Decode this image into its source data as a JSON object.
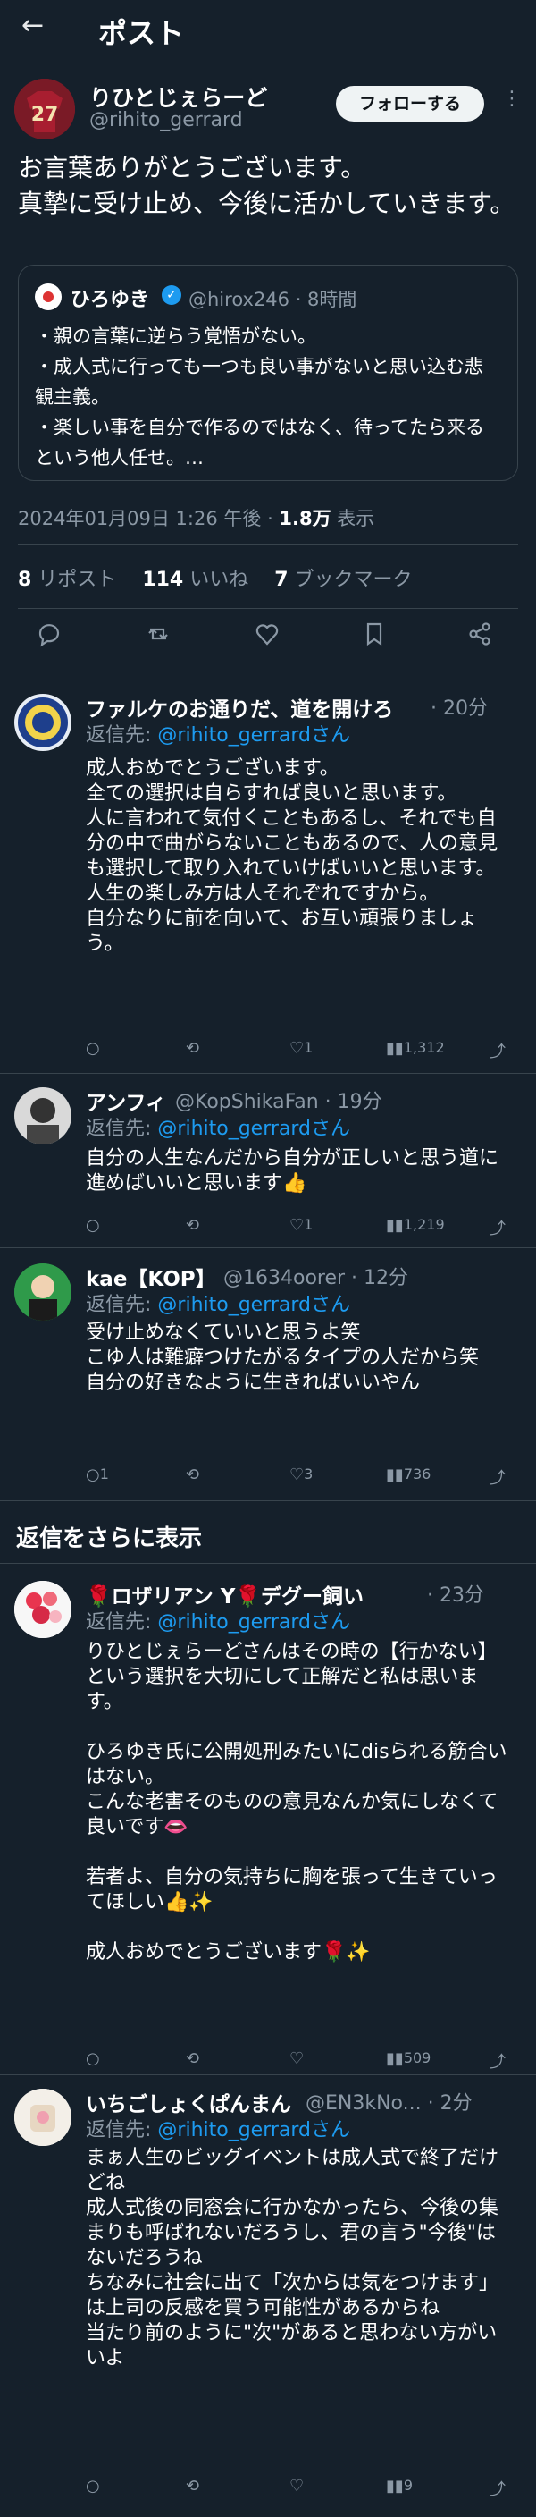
{
  "header": {
    "back_icon": "←",
    "title": "ポスト"
  },
  "main_post": {
    "author_name": "りひとじぇらーど",
    "author_handle": "@rihito_gerrard",
    "avatar_text": "27",
    "follow_label": "フォローする",
    "more_icon": "⋮",
    "text": "お言葉ありがとうございます。\n真摯に受け止め、今後に活かしていきます。",
    "quote": {
      "name": "ひろゆき",
      "handle": "@hirox246 · 8時間",
      "text": "・親の言葉に逆らう覚悟がない。\n・成人式に行っても一つも良い事がないと思い込む悲観主義。\n・楽しい事を自分で作るのではなく、待ってたら来るという他人任せ。…"
    },
    "timestamp_prefix": "2024年01月09日 1:26 午後 · ",
    "views_count": "1.8万",
    "views_label": " 表示",
    "reposts_count": "8",
    "reposts_label": " リポスト",
    "likes_count": "114",
    "likes_label": " いいね",
    "bookmarks_count": "7",
    "bookmarks_label": " ブックマーク",
    "actions": {
      "reply": "💬",
      "repost": "⟲",
      "like": "♡",
      "bookmark": "🔖",
      "share": "⤴"
    }
  },
  "replies": [
    {
      "name": "ファルケのお通りだ、道を開けろ",
      "meta": "· 20分",
      "reply_to_label": "返信先: ",
      "reply_to_handle": "@rihito_gerrardさん",
      "text": "成人おめでとうございます。\n全ての選択は自らすれば良いと思います。\n人に言われて気付くこともあるし、それでも自分の中で曲がらないこともあるので、人の意見も選択して取り入れていけばいいと思います。\n人生の楽しみ方は人それぞれですから。\n自分なりに前を向いて、お互い頑張りましょう。",
      "counts": {
        "reply": "",
        "repost": "",
        "like": "1",
        "views": "1,312"
      }
    },
    {
      "name": "アンフィ",
      "meta": "@KopShikaFan · 19分",
      "reply_to_label": "返信先: ",
      "reply_to_handle": "@rihito_gerrardさん",
      "text": "自分の人生なんだから自分が正しいと思う道に進めばいいと思います👍",
      "counts": {
        "reply": "",
        "repost": "",
        "like": "1",
        "views": "1,219"
      }
    },
    {
      "name": "kae【KOP】",
      "meta": "@1634oorer · 12分",
      "reply_to_label": "返信先: ",
      "reply_to_handle": "@rihito_gerrardさん",
      "text": "受け止めなくていいと思うよ笑\nこゆ人は難癖つけたがるタイプの人だから笑\n自分の好きなように生きればいいやん",
      "counts": {
        "reply": "1",
        "repost": "",
        "like": "3",
        "views": "736"
      }
    },
    {
      "name": "🌹ロザリアン Y🌹デグー飼い",
      "meta": "· 23分",
      "reply_to_label": "返信先: ",
      "reply_to_handle": "@rihito_gerrardさん",
      "text": "りひとじぇらーどさんはその時の【行かない】という選択を大切にして正解だと私は思います。\n\nひろゆき氏に公開処刑みたいにdisられる筋合いはない。\nこんな老害そのものの意見なんか気にしなくて良いです👄\n\n若者よ、自分の気持ちに胸を張って生きていってほしい👍✨\n\n成人おめでとうございます🌹✨",
      "counts": {
        "reply": "",
        "repost": "",
        "like": "",
        "views": "509"
      }
    },
    {
      "name": "いちごしょくぱんまん",
      "meta": "@EN3kNo... · 2分",
      "reply_to_label": "返信先: ",
      "reply_to_handle": "@rihito_gerrardさん",
      "text": "まぁ人生のビッグイベントは成人式で終了だけどね\n成人式後の同窓会に行かなかったら、今後の集まりも呼ばれないだろうし、君の言う\"今後\"はないだろうね\nちなみに社会に出て「次からは気をつけます」は上司の反感を買う可能性があるからね\n当たり前のように\"次\"があると思わない方がいいよ",
      "counts": {
        "reply": "",
        "repost": "",
        "like": "",
        "views": "9"
      }
    }
  ],
  "show_more_label": "返信をさらに表示",
  "reply_action_icons": {
    "reply": "○",
    "repost": "⟲",
    "like": "♡",
    "views": "📊",
    "share": "⤴"
  },
  "colors": {
    "background": "#15202b",
    "link": "#1d9bf0",
    "muted": "#8b98a5",
    "divider": "#38444d"
  }
}
